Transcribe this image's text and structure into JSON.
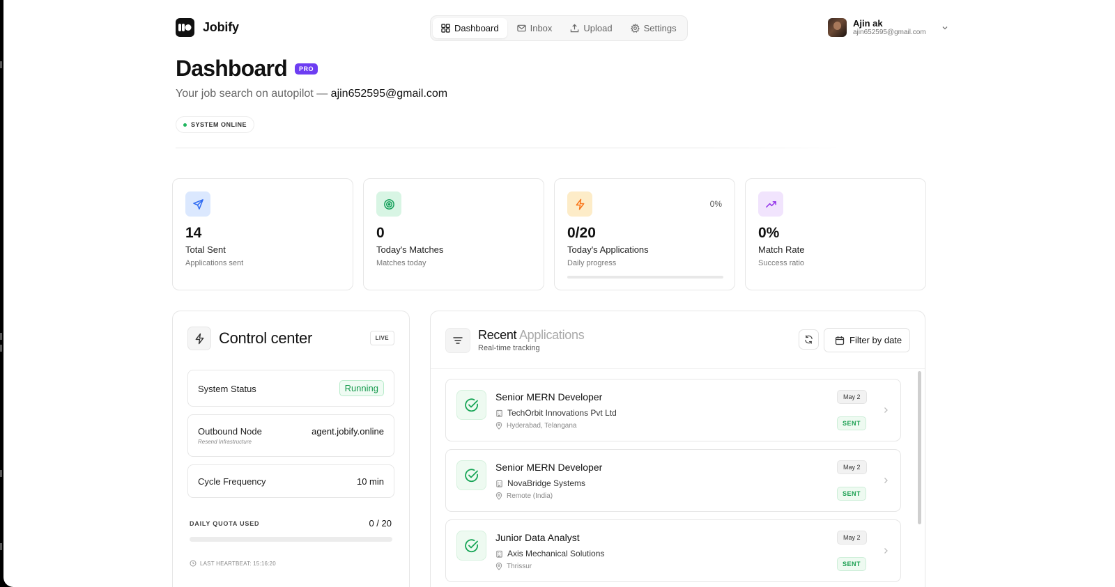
{
  "brand": {
    "name": "Jobify"
  },
  "nav": {
    "items": [
      {
        "label": "Dashboard",
        "icon": "dashboard-icon",
        "active": true
      },
      {
        "label": "Inbox",
        "icon": "mail-icon",
        "active": false
      },
      {
        "label": "Upload",
        "icon": "upload-icon",
        "active": false
      },
      {
        "label": "Settings",
        "icon": "gear-icon",
        "active": false
      }
    ]
  },
  "user": {
    "name": "Ajin ak",
    "email": "ajin652595@gmail.com"
  },
  "header": {
    "title": "Dashboard",
    "badge": "PRO",
    "subtitle_prefix": "Your job search on autopilot —",
    "subtitle_email": "ajin652595@gmail.com",
    "status_pill": "SYSTEM ONLINE"
  },
  "stats": [
    {
      "value": "14",
      "label": "Total Sent",
      "sub": "Applications sent",
      "icon": "send-icon",
      "color": "#2f6bf2",
      "bg": "#dbe8fe"
    },
    {
      "value": "0",
      "label": "Today's Matches",
      "sub": "Matches today",
      "icon": "target-icon",
      "color": "#14a05a",
      "bg": "#d8f5e4"
    },
    {
      "value": "0/20",
      "label": "Today's Applications",
      "sub": "Daily progress",
      "icon": "bolt-icon",
      "color": "#f97316",
      "bg": "#fdecc8",
      "percent": "0%",
      "progress": 0
    },
    {
      "value": "0%",
      "label": "Match Rate",
      "sub": "Success ratio",
      "icon": "trending-up-icon",
      "color": "#9333ea",
      "bg": "#f1e4fd"
    }
  ],
  "control": {
    "title": "Control center",
    "live": "LIVE",
    "system_status_label": "System Status",
    "system_status_value": "Running",
    "outbound_label": "Outbound Node",
    "outbound_sub": "Resend Infrastructure",
    "outbound_value": "agent.jobify.online",
    "cycle_label": "Cycle Frequency",
    "cycle_value": "10 min",
    "quota_label": "DAILY QUOTA USED",
    "quota_value": "0 / 20",
    "quota_progress": 0,
    "heartbeat": "LAST HEARTBEAT: 15:16:20"
  },
  "recent": {
    "title_a": "Recent",
    "title_b": "Applications",
    "subtitle": "Real-time tracking",
    "filter_label": "Filter by date",
    "jobs": [
      {
        "title": "Senior MERN Developer",
        "company": "TechOrbit Innovations Pvt Ltd",
        "location": "Hyderabad, Telangana",
        "date": "May 2",
        "status": "SENT"
      },
      {
        "title": "Senior MERN Developer",
        "company": "NovaBridge Systems",
        "location": "Remote (India)",
        "date": "May 2",
        "status": "SENT"
      },
      {
        "title": "Junior Data Analyst",
        "company": "Axis Mechanical Solutions",
        "location": "Thrissur",
        "date": "May 2",
        "status": "SENT"
      }
    ]
  }
}
